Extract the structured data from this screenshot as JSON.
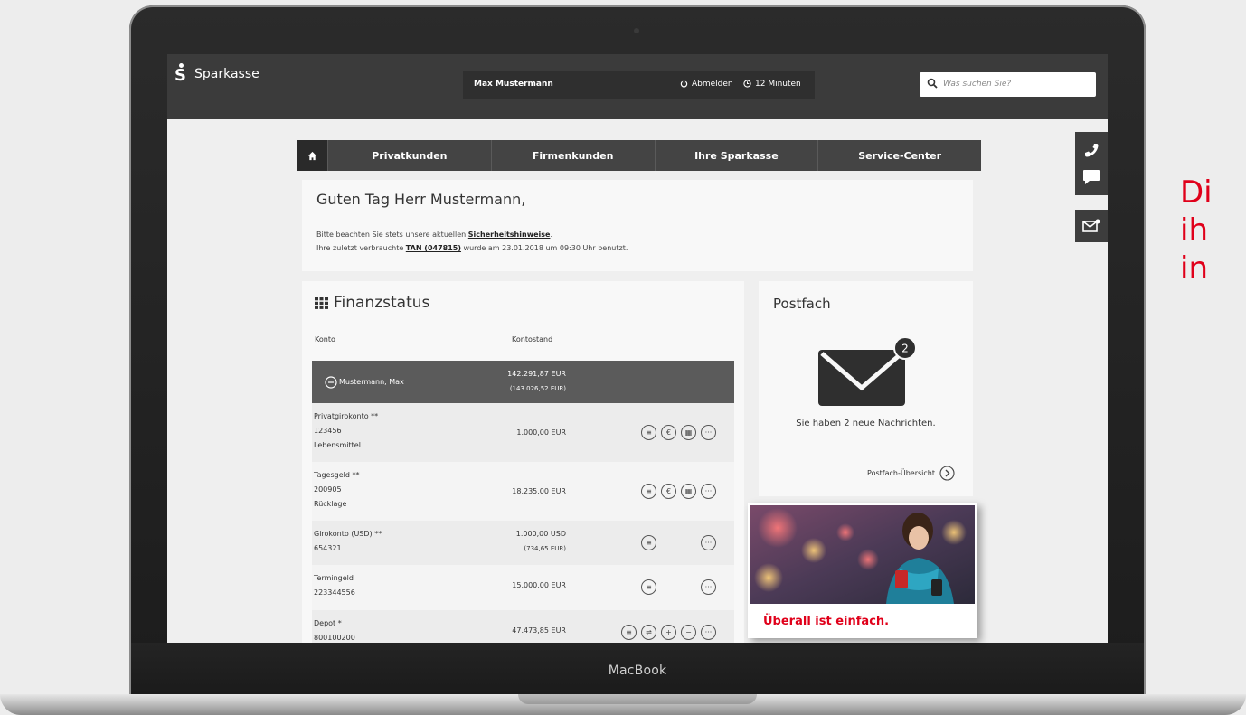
{
  "device": {
    "label": "MacBook"
  },
  "side_text": [
    "Di",
    "ih",
    "in"
  ],
  "header": {
    "brand": "Sparkasse",
    "user_name": "Max Mustermann",
    "logout_label": "Abmelden",
    "timer_label": "12 Minuten",
    "search_placeholder": "Was suchen Sie?"
  },
  "nav": {
    "items": [
      "Privatkunden",
      "Firmenkunden",
      "Ihre Sparkasse",
      "Service-Center"
    ]
  },
  "greeting": {
    "title": "Guten Tag Herr Mustermann,",
    "line1_prefix": "Bitte beachten Sie stets unsere aktuellen ",
    "line1_link": "Sicherheitshinweise",
    "line1_suffix": ".",
    "line2_prefix": "Ihre zuletzt verbrauchte ",
    "line2_tan": "TAN (047815)",
    "line2_suffix": " wurde am 23.01.2018 um 09:30 Uhr benutzt."
  },
  "finanzstatus": {
    "title": "Finanzstatus",
    "col_konto": "Konto",
    "col_kontostand": "Kontostand",
    "group": {
      "name": "Mustermann, Max",
      "amount": "142.291,87 EUR",
      "amount_sub": "(143.026,52 EUR)"
    },
    "accounts": [
      {
        "name": "Privatgirokonto **",
        "number": "123456",
        "note": "Lebensmittel",
        "amount": "1.000,00 EUR",
        "amount_sub": ""
      },
      {
        "name": "Tagesgeld **",
        "number": "200905",
        "note": "Rücklage",
        "amount": "18.235,00 EUR",
        "amount_sub": ""
      },
      {
        "name": "Girokonto (USD) **",
        "number": "654321",
        "note": "",
        "amount": "1.000,00 USD",
        "amount_sub": "(734,65 EUR)"
      },
      {
        "name": "Termingeld",
        "number": "223344556",
        "note": "",
        "amount": "15.000,00 EUR",
        "amount_sub": ""
      },
      {
        "name": "Depot *",
        "number": "800100200",
        "note": "",
        "amount": "47.473,85 EUR",
        "amount_sub": ""
      }
    ]
  },
  "postfach": {
    "title": "Postfach",
    "badge": "2",
    "message": "Sie haben 2 neue Nachrichten.",
    "link": "Postfach-Übersicht"
  },
  "promo": {
    "text": "Überall ist einfach."
  },
  "colors": {
    "accent_red": "#e0001a",
    "header_dark": "#3b3b3b",
    "nav_dark": "#444444"
  }
}
